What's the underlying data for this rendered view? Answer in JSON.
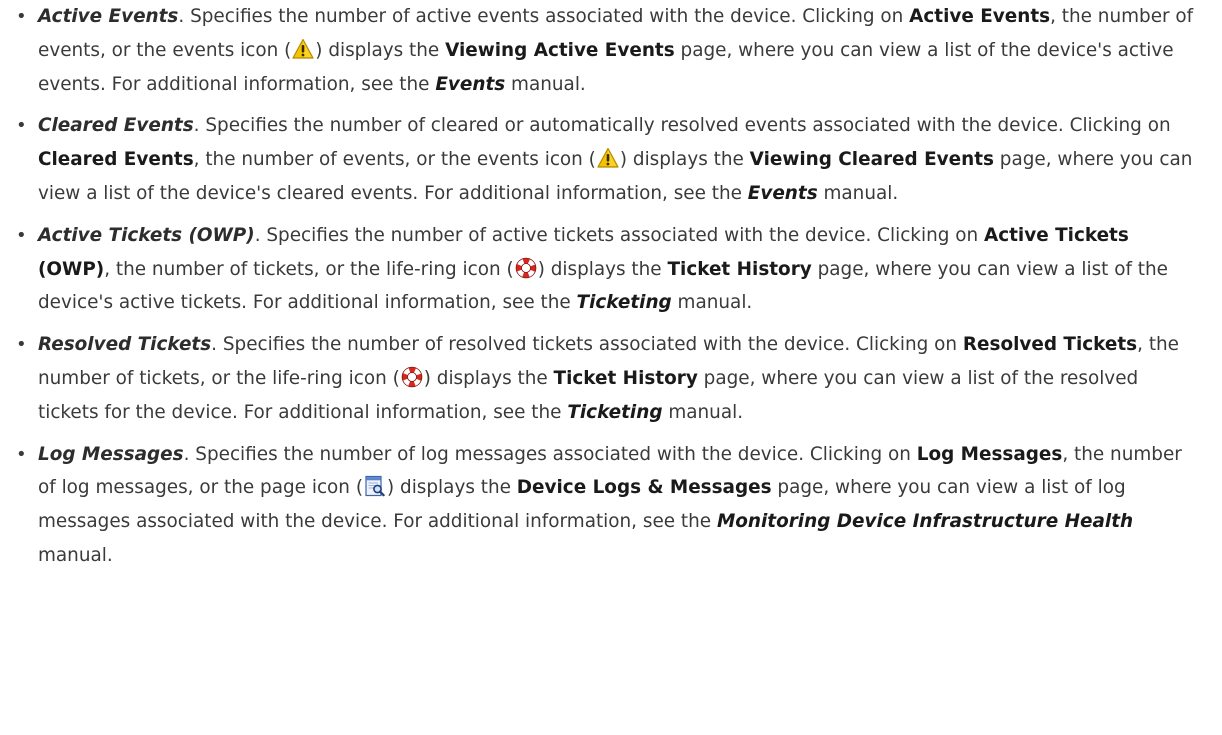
{
  "items": [
    {
      "term": "Active Events",
      "lead": ". Specifies the number of active events associated with the device. Clicking on ",
      "ui1": "Active Events",
      "mid": ", the number of events, or the events icon (",
      "icon": "warning-icon",
      "post_icon": ") displays the ",
      "ui2": "Viewing Active Events",
      "tail": " page, where you can view a list of the device's active events. For additional information, see the ",
      "manual": "Events",
      "end": " manual."
    },
    {
      "term": "Cleared Events",
      "lead": ". Specifies the number of cleared or automatically resolved events associated with the device. Clicking on ",
      "ui1": "Cleared Events",
      "mid": ", the number of events, or the events icon (",
      "icon": "warning-icon",
      "post_icon": ") displays the ",
      "ui2": "Viewing Cleared Events",
      "tail": " page, where you can view a list of the device's cleared events. For additional information, see the ",
      "manual": "Events",
      "end": " manual."
    },
    {
      "term": "Active Tickets (OWP)",
      "lead": ". Specifies the number of active tickets associated with the device. Clicking on ",
      "ui1": "Active Tickets (OWP)",
      "mid": ", the number of tickets, or the life-ring icon (",
      "icon": "life-ring-icon",
      "post_icon": ") displays the ",
      "ui2": "Ticket History",
      "tail": " page, where you can view a list of the device's active tickets. For additional information, see the ",
      "manual": "Ticketing",
      "end": " manual."
    },
    {
      "term": "Resolved Tickets",
      "lead": ". Specifies the number of resolved tickets associated with the device. Clicking on ",
      "ui1": "Resolved Tickets",
      "mid": ", the number of tickets, or the life-ring icon (",
      "icon": "life-ring-icon",
      "post_icon": ") displays the ",
      "ui2": "Ticket History",
      "tail": " page, where you can view a list of the resolved tickets for the device. For additional information, see the ",
      "manual": "Ticketing",
      "end": " manual."
    },
    {
      "term": "Log Messages",
      "lead": ". Specifies the number of log messages associated with the device. Clicking on ",
      "ui1": "Log Messages",
      "mid": ", the number of log messages, or the page icon (",
      "icon": "page-search-icon",
      "post_icon": ") displays the ",
      "ui2": "Device Logs & Messages",
      "tail": " page, where you can view a list of log messages associated with the device. For additional information, see the ",
      "manual": "Monitoring Device Infrastructure Health",
      "end": " manual."
    }
  ],
  "bullet_glyph": "•",
  "colors": {
    "text": "#3a3a3a",
    "warning_fill": "#f5c400",
    "life_ring": "#d8261c"
  }
}
